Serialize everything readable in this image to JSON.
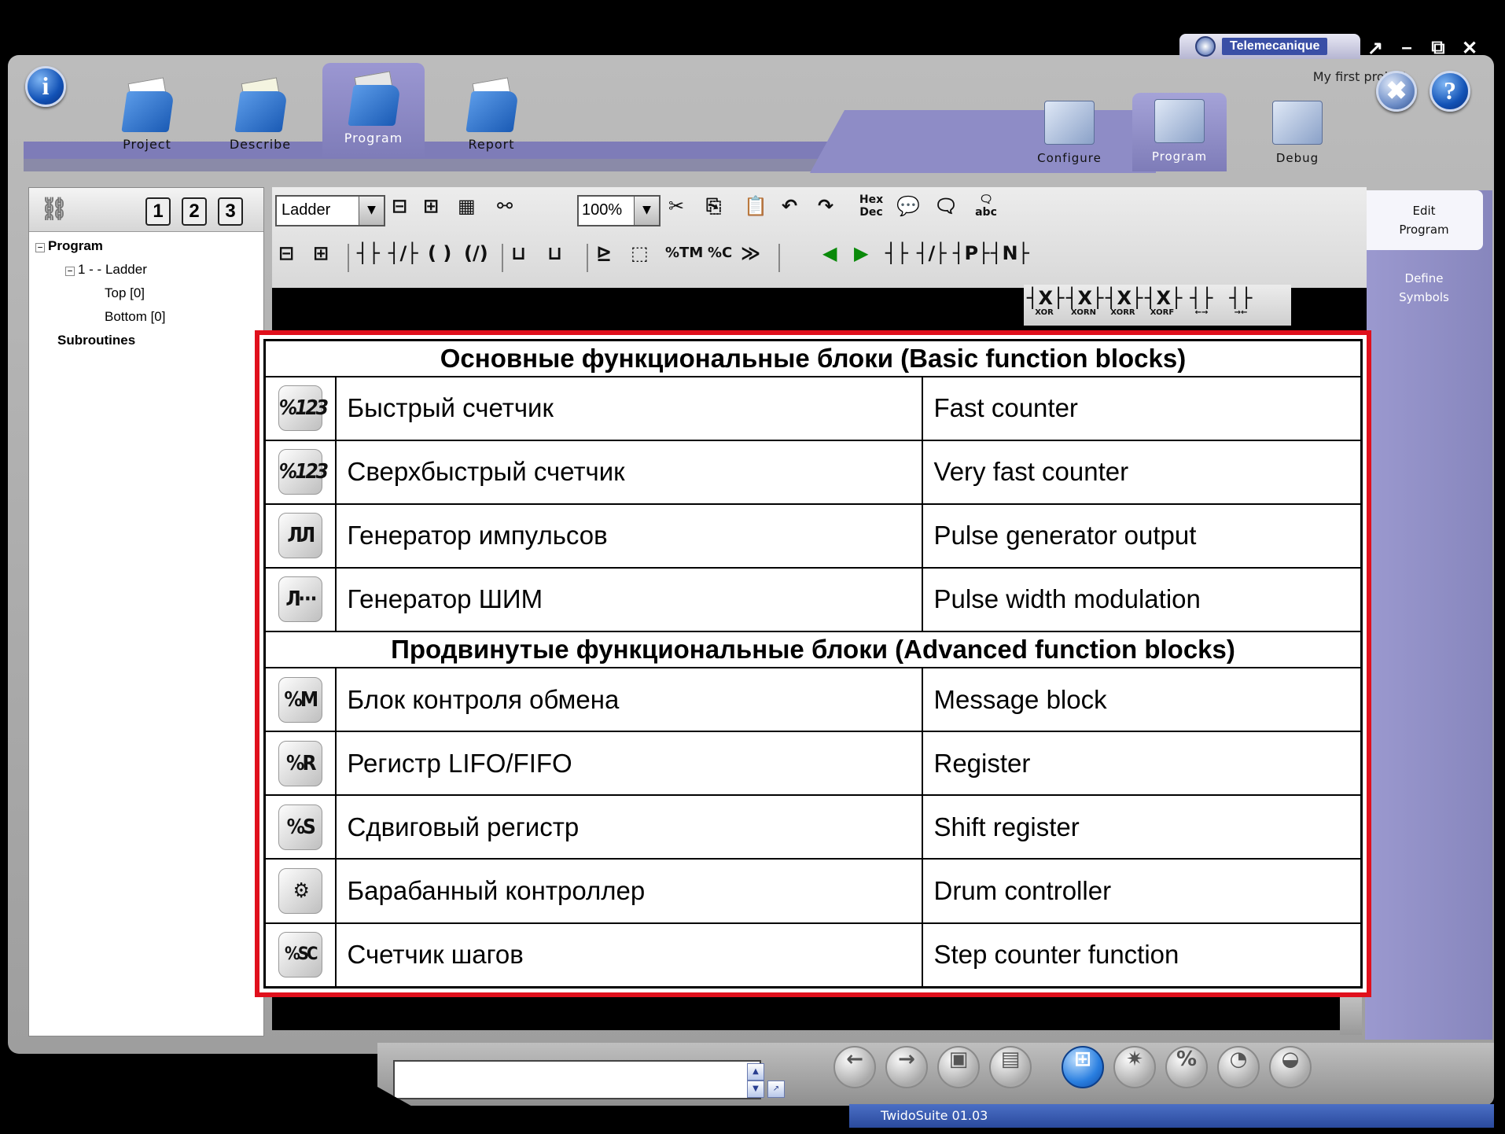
{
  "brand": {
    "name": "Telemecanique",
    "project_name": "My first project"
  },
  "window_controls": {
    "restore_label": "↗",
    "minimize_label": "–",
    "maximize_label": "⧉",
    "close_label": "✕"
  },
  "top_buttons": {
    "info_icon": "info-icon",
    "help_label": "?"
  },
  "main_tabs": [
    {
      "label": "Project",
      "icon": "project-folder-icon"
    },
    {
      "label": "Describe",
      "icon": "describe-folder-icon"
    },
    {
      "label": "Program",
      "icon": "program-folder-icon",
      "active": true
    },
    {
      "label": "Report",
      "icon": "report-folder-icon"
    }
  ],
  "sub_tabs": [
    {
      "label": "Configure"
    },
    {
      "label": "Program",
      "active": true
    },
    {
      "label": "Debug"
    }
  ],
  "side_panel": {
    "edit_program": "Edit\nProgram",
    "define_symbols": "Define\nSymbols"
  },
  "tree": {
    "numbers": [
      "1",
      "2",
      "3"
    ],
    "items": [
      {
        "label": "Program",
        "bold": true
      },
      {
        "label": "1 -  - Ladder"
      },
      {
        "label": "Top [0]"
      },
      {
        "label": "Bottom [0]"
      },
      {
        "label": "Subroutines",
        "bold": true
      }
    ]
  },
  "toolbar": {
    "language": "Ladder",
    "zoom": "100%",
    "hexdec_label": "Hex\nDec",
    "comment_abc_label": "abc"
  },
  "extra_buttons": [
    {
      "label": "XOR"
    },
    {
      "label": "XORN"
    },
    {
      "label": "XORR"
    },
    {
      "label": "XORF"
    },
    {
      "label": ""
    },
    {
      "label": ""
    }
  ],
  "function_blocks": {
    "basic_header": "Основные функциональные блоки (Basic function blocks)",
    "advanced_header": "Продвинутые функциональные блоки (Advanced function blocks)",
    "basic": [
      {
        "icon_text": "%123",
        "ru": "Быстрый счетчик",
        "en": "Fast counter"
      },
      {
        "icon_text": "%123",
        "ru": "Сверхбыстрый счетчик",
        "en": "Very fast counter"
      },
      {
        "icon_text": "ЛЛ",
        "ru": "Генератор импульсов",
        "en": "Pulse generator output"
      },
      {
        "icon_text": "Л⋯",
        "ru": "Генератор ШИМ",
        "en": "Pulse width modulation"
      }
    ],
    "advanced": [
      {
        "icon_text": "%M",
        "ru": "Блок контроля обмена",
        "en": "Message block"
      },
      {
        "icon_text": "%R",
        "ru": "Регистр LIFO/FIFO",
        "en": "Register"
      },
      {
        "icon_text": "%S",
        "ru": "Сдвиговый регистр",
        "en": "Shift register"
      },
      {
        "icon_text": "⚙",
        "ru": "Барабанный контроллер",
        "en": "Drum controller"
      },
      {
        "icon_text": "%SC",
        "ru": "Счетчик шагов",
        "en": "Step counter function"
      }
    ]
  },
  "status": {
    "version": "TwidoSuite 01.03"
  }
}
